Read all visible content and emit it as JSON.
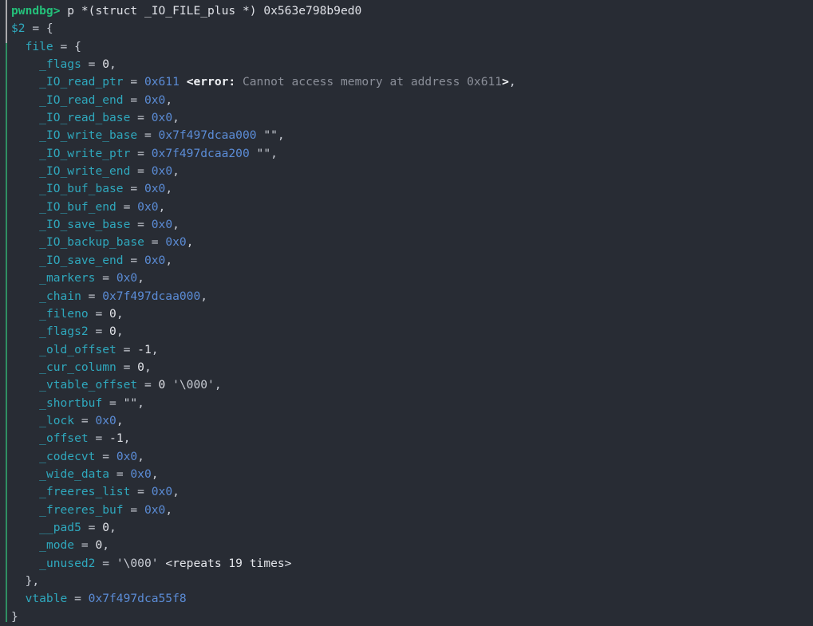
{
  "terminal": {
    "background_color": "#282c34",
    "gutter": {
      "top_color": "#a9a9ab",
      "bottom_color": "#2f8f63"
    },
    "colors": {
      "prompt": "#24c07a",
      "identifier": "#2fa8bd",
      "pointer": "#5b8cd6",
      "number": "#e3e5ea",
      "punctuation": "#c8ccd4",
      "error_label": "#f0f2f5",
      "error_text": "#8b8f99"
    },
    "prompt_label": "pwndbg>",
    "command": "p *(struct _IO_FILE_plus *) 0x563e798b9ed0",
    "result_id": "$2",
    "lines": [
      {
        "indent": 0,
        "type": "prompt",
        "prompt": "pwndbg>",
        "command": " p *(struct _IO_FILE_plus *) 0x563e798b9ed0"
      },
      {
        "indent": 0,
        "type": "assign_open",
        "name": "$2",
        "open": " = {"
      },
      {
        "indent": 2,
        "type": "assign_open",
        "name": "file",
        "open": " = {"
      },
      {
        "indent": 4,
        "type": "field",
        "name": "_flags",
        "value": "0",
        "value_kind": "num",
        "trail": ","
      },
      {
        "indent": 4,
        "type": "field_error",
        "name": "_IO_read_ptr",
        "value": "0x611",
        "value_kind": "hex",
        "error_open": "<error:",
        "error_text": " Cannot access memory at address 0x611",
        "error_close": ">",
        "trail": ","
      },
      {
        "indent": 4,
        "type": "field",
        "name": "_IO_read_end",
        "value": "0x0",
        "value_kind": "hex",
        "trail": ","
      },
      {
        "indent": 4,
        "type": "field",
        "name": "_IO_read_base",
        "value": "0x0",
        "value_kind": "hex",
        "trail": ","
      },
      {
        "indent": 4,
        "type": "field",
        "name": "_IO_write_base",
        "value": "0x7f497dcaa000",
        "value_kind": "hex",
        "suffix": " \"\"",
        "trail": ","
      },
      {
        "indent": 4,
        "type": "field",
        "name": "_IO_write_ptr",
        "value": "0x7f497dcaa200",
        "value_kind": "hex",
        "suffix": " \"\"",
        "trail": ","
      },
      {
        "indent": 4,
        "type": "field",
        "name": "_IO_write_end",
        "value": "0x0",
        "value_kind": "hex",
        "trail": ","
      },
      {
        "indent": 4,
        "type": "field",
        "name": "_IO_buf_base",
        "value": "0x0",
        "value_kind": "hex",
        "trail": ","
      },
      {
        "indent": 4,
        "type": "field",
        "name": "_IO_buf_end",
        "value": "0x0",
        "value_kind": "hex",
        "trail": ","
      },
      {
        "indent": 4,
        "type": "field",
        "name": "_IO_save_base",
        "value": "0x0",
        "value_kind": "hex",
        "trail": ","
      },
      {
        "indent": 4,
        "type": "field",
        "name": "_IO_backup_base",
        "value": "0x0",
        "value_kind": "hex",
        "trail": ","
      },
      {
        "indent": 4,
        "type": "field",
        "name": "_IO_save_end",
        "value": "0x0",
        "value_kind": "hex",
        "trail": ","
      },
      {
        "indent": 4,
        "type": "field",
        "name": "_markers",
        "value": "0x0",
        "value_kind": "hex",
        "trail": ","
      },
      {
        "indent": 4,
        "type": "field",
        "name": "_chain",
        "value": "0x7f497dcaa000",
        "value_kind": "hex",
        "trail": ","
      },
      {
        "indent": 4,
        "type": "field",
        "name": "_fileno",
        "value": "0",
        "value_kind": "num",
        "trail": ","
      },
      {
        "indent": 4,
        "type": "field",
        "name": "_flags2",
        "value": "0",
        "value_kind": "num",
        "trail": ","
      },
      {
        "indent": 4,
        "type": "field",
        "name": "_old_offset",
        "value": "-1",
        "value_kind": "num",
        "trail": ","
      },
      {
        "indent": 4,
        "type": "field",
        "name": "_cur_column",
        "value": "0",
        "value_kind": "num",
        "trail": ","
      },
      {
        "indent": 4,
        "type": "field",
        "name": "_vtable_offset",
        "value": "0",
        "value_kind": "num",
        "suffix": " '\\000'",
        "trail": ","
      },
      {
        "indent": 4,
        "type": "field",
        "name": "_shortbuf",
        "value": "\"\"",
        "value_kind": "str",
        "trail": ","
      },
      {
        "indent": 4,
        "type": "field",
        "name": "_lock",
        "value": "0x0",
        "value_kind": "hex",
        "trail": ","
      },
      {
        "indent": 4,
        "type": "field",
        "name": "_offset",
        "value": "-1",
        "value_kind": "num",
        "trail": ","
      },
      {
        "indent": 4,
        "type": "field",
        "name": "_codecvt",
        "value": "0x0",
        "value_kind": "hex",
        "trail": ","
      },
      {
        "indent": 4,
        "type": "field",
        "name": "_wide_data",
        "value": "0x0",
        "value_kind": "hex",
        "trail": ","
      },
      {
        "indent": 4,
        "type": "field",
        "name": "_freeres_list",
        "value": "0x0",
        "value_kind": "hex",
        "trail": ","
      },
      {
        "indent": 4,
        "type": "field",
        "name": "_freeres_buf",
        "value": "0x0",
        "value_kind": "hex",
        "trail": ","
      },
      {
        "indent": 4,
        "type": "field",
        "name": "__pad5",
        "value": "0",
        "value_kind": "num",
        "trail": ","
      },
      {
        "indent": 4,
        "type": "field",
        "name": "_mode",
        "value": "0",
        "value_kind": "num",
        "trail": ","
      },
      {
        "indent": 4,
        "type": "field",
        "name": "_unused2",
        "value": "'\\000'",
        "value_kind": "str",
        "meta": " <repeats 19 times>",
        "trail": ""
      },
      {
        "indent": 2,
        "type": "close",
        "text": "},"
      },
      {
        "indent": 2,
        "type": "field",
        "name": "vtable",
        "value": "0x7f497dca55f8",
        "value_kind": "hex",
        "trail": ""
      },
      {
        "indent": 0,
        "type": "close",
        "text": "}"
      }
    ]
  }
}
